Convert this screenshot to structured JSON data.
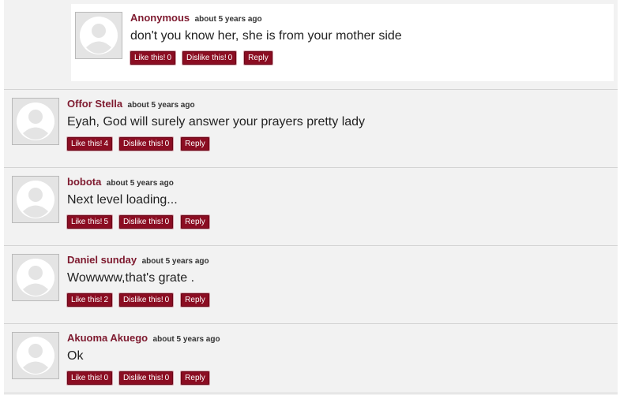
{
  "comments": [
    {
      "author": "Anonymous",
      "time": "about 5 years ago",
      "text": "don't you know her, she is from your mother side",
      "like_label": "Like this!",
      "like_count": "0",
      "dislike_label": "Dislike this!",
      "dislike_count": "0",
      "reply_label": "Reply"
    },
    {
      "author": "Offor Stella",
      "time": "about 5 years ago",
      "text": "Eyah, God will surely answer your prayers pretty lady",
      "like_label": "Like this!",
      "like_count": "4",
      "dislike_label": "Dislike this!",
      "dislike_count": "0",
      "reply_label": "Reply"
    },
    {
      "author": "bobota",
      "time": "about 5 years ago",
      "text": "Next level loading...",
      "like_label": "Like this!",
      "like_count": "5",
      "dislike_label": "Dislike this!",
      "dislike_count": "0",
      "reply_label": "Reply"
    },
    {
      "author": "Daniel sunday",
      "time": "about 5 years ago",
      "text": "Wowwww,that's grate .",
      "like_label": "Like this!",
      "like_count": "2",
      "dislike_label": "Dislike this!",
      "dislike_count": "0",
      "reply_label": "Reply"
    },
    {
      "author": "Akuoma Akuego",
      "time": "about 5 years ago",
      "text": "Ok",
      "like_label": "Like this!",
      "like_count": "0",
      "dislike_label": "Dislike this!",
      "dislike_count": "0",
      "reply_label": "Reply"
    }
  ],
  "icons": {
    "avatar": "default-user-avatar-icon"
  },
  "colors": {
    "accent": "#8b0d22",
    "author": "#7e1a2f",
    "panel": "#f2f2f2"
  }
}
